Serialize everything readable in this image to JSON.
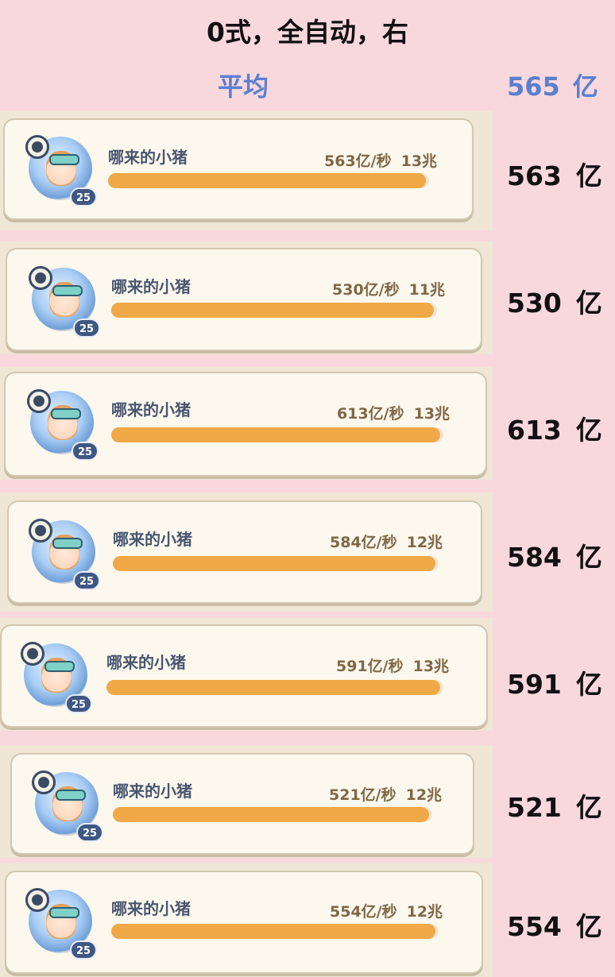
{
  "header": {
    "title": "0式，全自动，右",
    "average_label": "平均",
    "average_value": "565",
    "average_unit": "亿"
  },
  "rows": [
    {
      "name": "哪来的小猪",
      "level": "25",
      "dps": "563亿/秒",
      "total": "13兆",
      "bar_fill_pct": 99,
      "result_value": "563",
      "result_unit": "亿"
    },
    {
      "name": "哪来的小猪",
      "level": "25",
      "dps": "530亿/秒",
      "total": "11兆",
      "bar_fill_pct": 99,
      "result_value": "530",
      "result_unit": "亿"
    },
    {
      "name": "哪来的小猪",
      "level": "25",
      "dps": "613亿/秒",
      "total": "13兆",
      "bar_fill_pct": 99,
      "result_value": "613",
      "result_unit": "亿"
    },
    {
      "name": "哪来的小猪",
      "level": "25",
      "dps": "584亿/秒",
      "total": "12兆",
      "bar_fill_pct": 99,
      "result_value": "584",
      "result_unit": "亿"
    },
    {
      "name": "哪来的小猪",
      "level": "25",
      "dps": "591亿/秒",
      "total": "13兆",
      "bar_fill_pct": 99,
      "result_value": "591",
      "result_unit": "亿"
    },
    {
      "name": "哪来的小猪",
      "level": "25",
      "dps": "521亿/秒",
      "total": "12兆",
      "bar_fill_pct": 99,
      "result_value": "521",
      "result_unit": "亿"
    },
    {
      "name": "哪来的小猪",
      "level": "25",
      "dps": "554亿/秒",
      "total": "12兆",
      "bar_fill_pct": 99,
      "result_value": "554",
      "result_unit": "亿"
    }
  ]
}
